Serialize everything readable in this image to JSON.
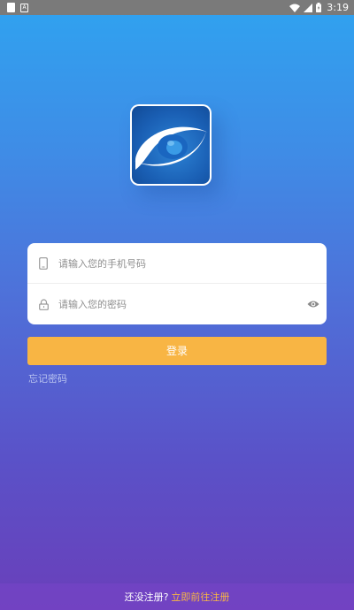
{
  "status_bar": {
    "time": "3:19",
    "left_icons": [
      "notification-icon",
      "app-notification-icon"
    ],
    "right_icons": [
      "wifi-icon",
      "signal-icon",
      "battery-icon"
    ]
  },
  "logo": {
    "icon": "app-logo-icon"
  },
  "form": {
    "phone": {
      "placeholder": "请输入您的手机号码",
      "value": "",
      "icon": "phone-icon"
    },
    "password": {
      "placeholder": "请输入您的密码",
      "value": "",
      "icon": "lock-icon",
      "toggle_icon": "eye-icon"
    }
  },
  "login_button": {
    "label": "登录"
  },
  "forgot_password": {
    "label": "忘记密码"
  },
  "bottom": {
    "prompt": "还没注册?",
    "register_link": "立即前往注册"
  },
  "colors": {
    "accent": "#f8b544",
    "gradient_top": "#2fa3f0",
    "gradient_bottom": "#6a3fba"
  }
}
